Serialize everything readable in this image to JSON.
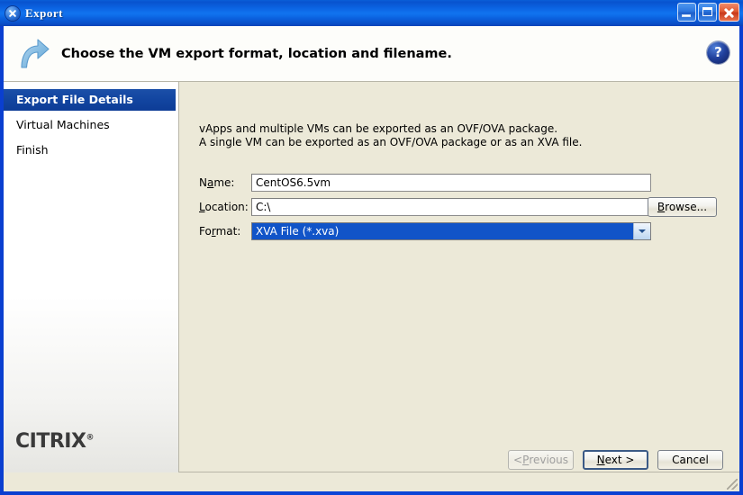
{
  "window": {
    "title": "Export",
    "icon": "close-x-circle-icon",
    "buttons": {
      "minimize": "minimize-icon",
      "maximize": "maximize-icon",
      "close": "close-icon"
    }
  },
  "banner": {
    "icon": "curved-arrow-icon",
    "title": "Choose the VM export format, location and filename.",
    "help_label": "?"
  },
  "sidebar": {
    "items": [
      {
        "label": "Export File Details",
        "selected": true
      },
      {
        "label": "Virtual Machines",
        "selected": false
      },
      {
        "label": "Finish",
        "selected": false
      }
    ],
    "logo": "CITRIX",
    "logo_mark": "®"
  },
  "main": {
    "intro_line1": "vApps and multiple VMs can be exported as an OVF/OVA package.",
    "intro_line2": "A single VM can be exported as an OVF/OVA package or as an XVA file.",
    "fields": {
      "name": {
        "label_pre": "N",
        "label_mnemonic": "a",
        "label_post": "me:",
        "value": "CentOS6.5vm",
        "placeholder": ""
      },
      "location": {
        "label_pre": "",
        "label_mnemonic": "L",
        "label_post": "ocation:",
        "value": "C:\\",
        "placeholder": ""
      },
      "format": {
        "label_pre": "Fo",
        "label_mnemonic": "r",
        "label_post": "mat:",
        "value": "XVA File (*.xva)",
        "arrow_icon": "chevron-down-icon"
      }
    },
    "browse": {
      "pre": "",
      "mnemonic": "B",
      "post": "rowse..."
    }
  },
  "footer": {
    "previous": {
      "pre": "< ",
      "mnemonic": "P",
      "post": "revious",
      "disabled": true
    },
    "next": {
      "pre": "",
      "mnemonic": "N",
      "post": "ext >",
      "default": true
    },
    "cancel": {
      "pre": "Cancel",
      "mnemonic": "",
      "post": "",
      "disabled": false
    }
  },
  "colors": {
    "titlebar_blue": "#0b63e2",
    "selection_blue": "#1154c8",
    "nav_selected": "#12459f",
    "panel_beige": "#ece9d8",
    "help_blue": "#20409c"
  }
}
